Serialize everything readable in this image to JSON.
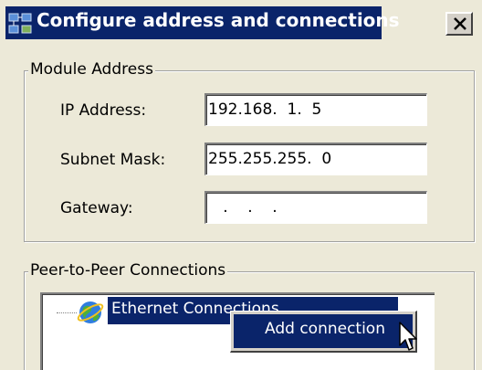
{
  "window": {
    "title": "Configure address and connections",
    "close_icon": "close-icon",
    "app_icon": "network-config-icon"
  },
  "module_address": {
    "legend": "Module Address",
    "ip_label": "IP Address:",
    "ip_value": "192.168.  1.  5",
    "subnet_label": "Subnet Mask:",
    "subnet_value": "255.255.255.  0",
    "gateway_label": "Gateway:",
    "gateway_value": "   .    .    ."
  },
  "peer_connections": {
    "legend": "Peer-to-Peer Connections",
    "tree_item_label": "Ethernet Connections",
    "tree_item_icon": "globe-icon"
  },
  "context_menu": {
    "items": [
      {
        "label": "Add connection"
      }
    ]
  },
  "colors": {
    "dialog_bg": "#ece9d8",
    "selection": "#0a246a",
    "selection_text": "#ffffff"
  }
}
